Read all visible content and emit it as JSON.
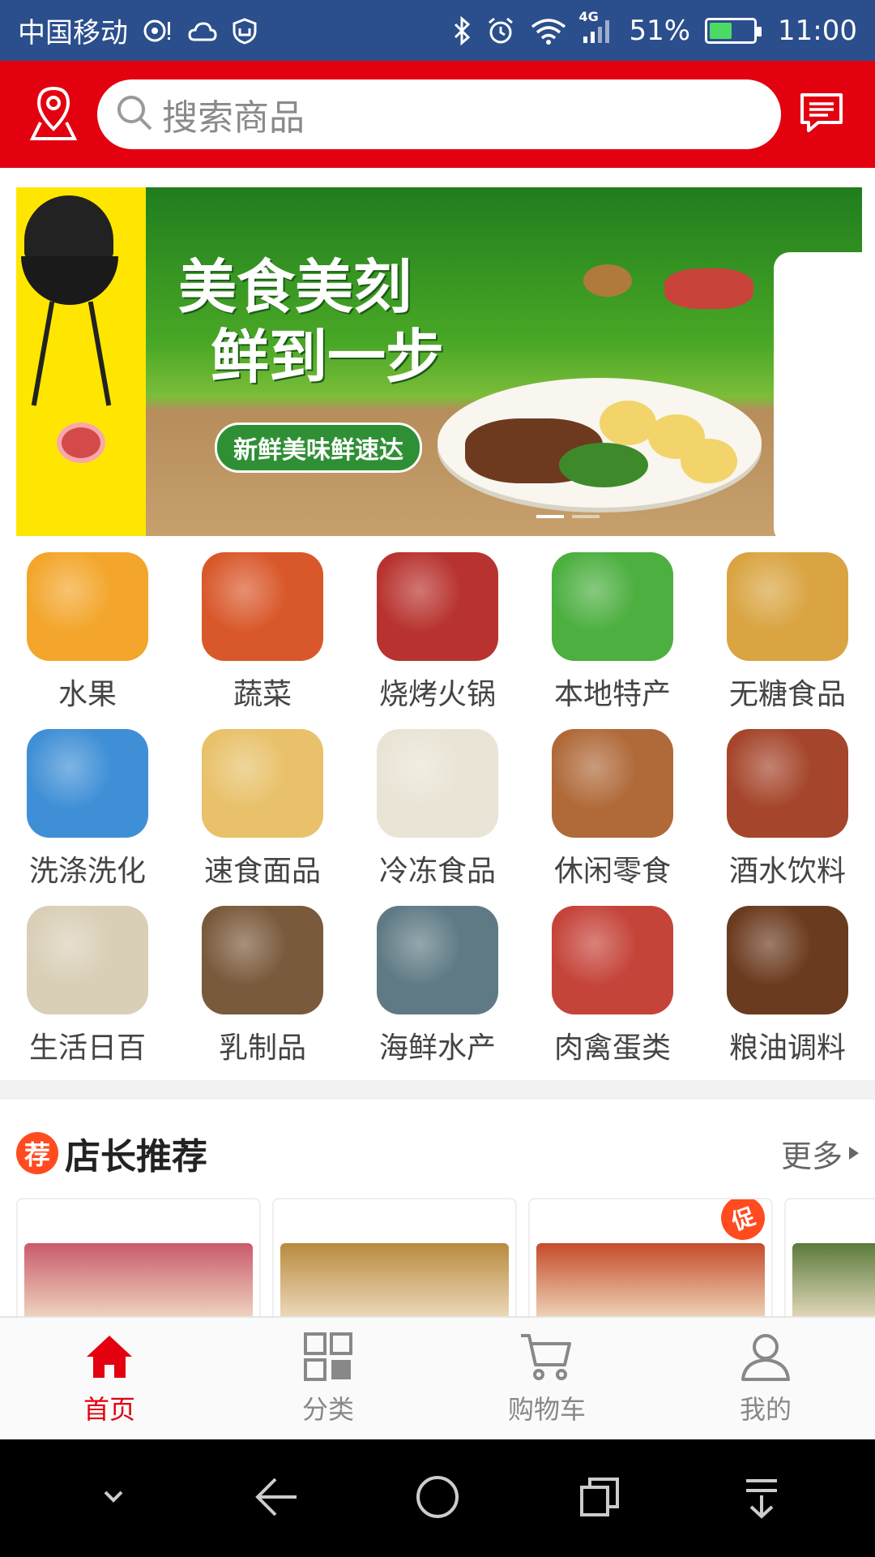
{
  "status_bar": {
    "carrier": "中国移动",
    "network": "4G",
    "battery_percent": "51%",
    "battery_level": 0.51,
    "time": "11:00"
  },
  "header": {
    "search_placeholder": "搜索商品",
    "location_icon": "map-pin-icon",
    "message_icon": "message-icon"
  },
  "banner": {
    "title_line1": "美食美刻",
    "title_line2": "鲜到一步",
    "subtitle": "新鲜美味鲜速达",
    "dot_count": 2,
    "active_dot": 0
  },
  "categories": [
    {
      "label": "水果",
      "color": "#f3a62b"
    },
    {
      "label": "蔬菜",
      "color": "#d9582b"
    },
    {
      "label": "烧烤火锅",
      "color": "#b8332f"
    },
    {
      "label": "本地特产",
      "color": "#4caf3f"
    },
    {
      "label": "无糖食品",
      "color": "#d9a441"
    },
    {
      "label": "洗涤洗化",
      "color": "#3f8fd6"
    },
    {
      "label": "速食面品",
      "color": "#e8c16a"
    },
    {
      "label": "冷冻食品",
      "color": "#e9e4d5"
    },
    {
      "label": "休闲零食",
      "color": "#b06a3a"
    },
    {
      "label": "酒水饮料",
      "color": "#a5452b"
    },
    {
      "label": "生活日百",
      "color": "#d9cfb7"
    },
    {
      "label": "乳制品",
      "color": "#7a5a3c"
    },
    {
      "label": "海鲜水产",
      "color": "#5f7a85"
    },
    {
      "label": "肉禽蛋类",
      "color": "#c5443a"
    },
    {
      "label": "粮油调料",
      "color": "#6b3b1f"
    }
  ],
  "recommend": {
    "badge": "荐",
    "title": "店长推荐",
    "more": "更多"
  },
  "products": [
    {
      "color": "#c95a6b",
      "promo": ""
    },
    {
      "color": "#b98a3e",
      "promo": ""
    },
    {
      "color": "#c54b2a",
      "promo": "促"
    },
    {
      "color": "#5a7a3a",
      "promo": ""
    }
  ],
  "tabbar": {
    "tabs": [
      {
        "label": "首页",
        "icon": "home-icon",
        "active": true
      },
      {
        "label": "分类",
        "icon": "grid-icon",
        "active": false
      },
      {
        "label": "购物车",
        "icon": "cart-icon",
        "active": false
      },
      {
        "label": "我的",
        "icon": "user-icon",
        "active": false
      }
    ]
  },
  "navbar": {
    "buttons": [
      "collapse-icon",
      "back-icon",
      "home-circle-icon",
      "recents-icon",
      "notification-pull-icon"
    ]
  },
  "colors": {
    "brand_red": "#e3000f",
    "status_blue": "#2b4e8c",
    "promo_orange": "#ff4b1f"
  }
}
